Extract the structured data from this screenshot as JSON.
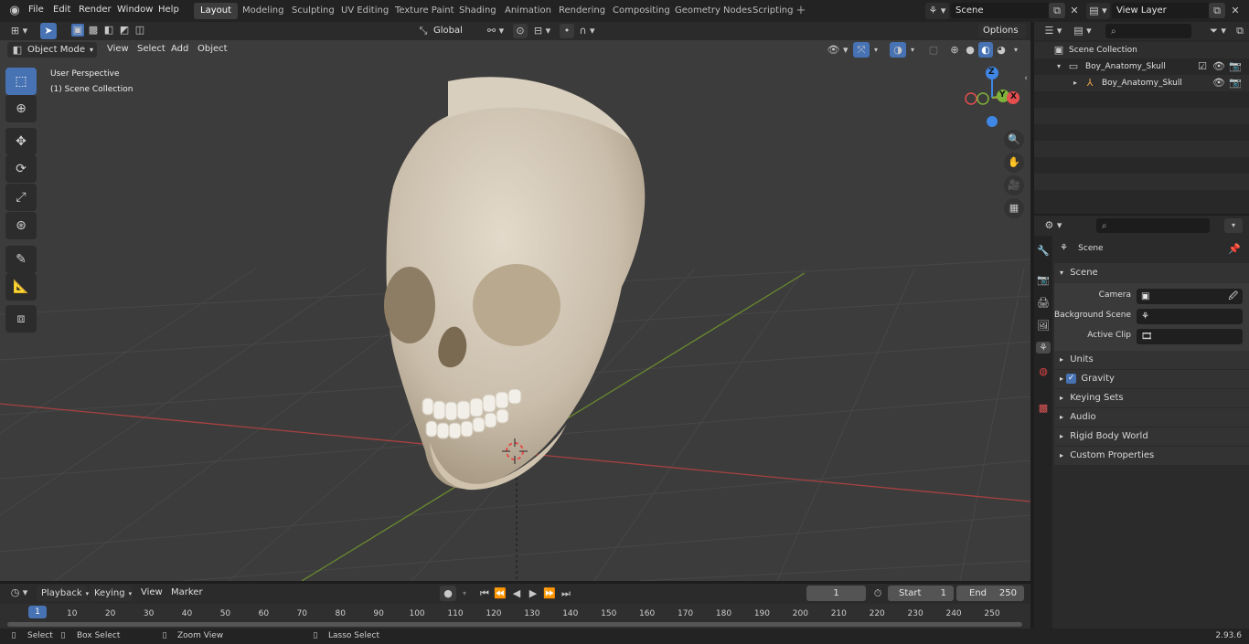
{
  "menu": [
    "File",
    "Edit",
    "Render",
    "Window",
    "Help"
  ],
  "workspaces": [
    "Layout",
    "Modeling",
    "Sculpting",
    "UV Editing",
    "Texture Paint",
    "Shading",
    "Animation",
    "Rendering",
    "Compositing",
    "Geometry Nodes",
    "Scripting"
  ],
  "active_workspace": "Layout",
  "scene_field": "Scene",
  "view_layer_field": "View Layer",
  "viewport_header": {
    "mode": "Object Mode",
    "menus": [
      "View",
      "Select",
      "Add",
      "Object"
    ],
    "transform": "Global",
    "options": "Options"
  },
  "overlay": {
    "perspective": "User Perspective",
    "collection": "(1) Scene Collection"
  },
  "gizmo": {
    "z": "Z",
    "y": "Y",
    "x": "X"
  },
  "outliner": {
    "root": "Scene Collection",
    "items": [
      {
        "label": "Boy_Anatomy_Skull",
        "type": "collection"
      },
      {
        "label": "Boy_Anatomy_Skull",
        "type": "object"
      }
    ]
  },
  "properties": {
    "context": "Scene",
    "panel_title": "Scene",
    "camera_label": "Camera",
    "bg_scene_label": "Background Scene",
    "active_clip_label": "Active Clip",
    "sections": [
      "Units",
      "Gravity",
      "Keying Sets",
      "Audio",
      "Rigid Body World",
      "Custom Properties"
    ]
  },
  "timeline": {
    "menus": [
      "Playback",
      "Keying",
      "View",
      "Marker"
    ],
    "current_frame": "1",
    "start_label": "Start",
    "start": "1",
    "end_label": "End",
    "end": "250",
    "ticks": [
      "1",
      "10",
      "20",
      "30",
      "40",
      "50",
      "60",
      "70",
      "80",
      "90",
      "100",
      "110",
      "120",
      "130",
      "140",
      "150",
      "160",
      "170",
      "180",
      "190",
      "200",
      "210",
      "220",
      "230",
      "240",
      "250"
    ]
  },
  "status": {
    "select": "Select",
    "box_select": "Box Select",
    "zoom_view": "Zoom View",
    "lasso_select": "Lasso Select",
    "version": "2.93.6"
  },
  "colors": {
    "accent": "#4772b3",
    "active_ws": "#3d3d3d",
    "viewport": "#3c3c3c",
    "x_axis": "#e44e4e",
    "y_axis": "#7fb23a",
    "z_axis": "#3f86e5"
  }
}
